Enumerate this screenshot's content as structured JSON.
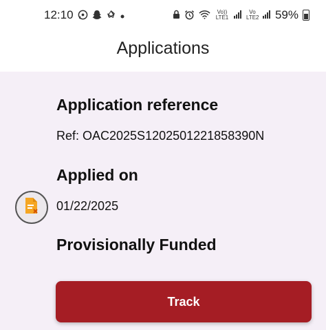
{
  "status_bar": {
    "time": "12:10",
    "battery": "59%",
    "volte1": "Vo)) LTE1",
    "volte2": "Vo LTE2",
    "left_icons": [
      "whatsapp-icon",
      "snapchat-icon",
      "recycle-icon",
      "dot-icon"
    ],
    "right_icons": [
      "lock-icon",
      "alarm-icon",
      "wifi-icon",
      "signal-icon",
      "battery-icon"
    ]
  },
  "header": {
    "title": "Applications"
  },
  "application": {
    "reference_label": "Application reference",
    "reference_value": "Ref: OAC2025S1202501221858390N",
    "applied_label": "Applied on",
    "applied_value": "01/22/2025",
    "status": "Provisionally Funded",
    "doc_icon": "document-icon"
  },
  "actions": {
    "track_label": "Track"
  },
  "colors": {
    "accent": "#a51d24",
    "card_bg": "#f5eff7",
    "doc_icon": "#f5a623"
  }
}
